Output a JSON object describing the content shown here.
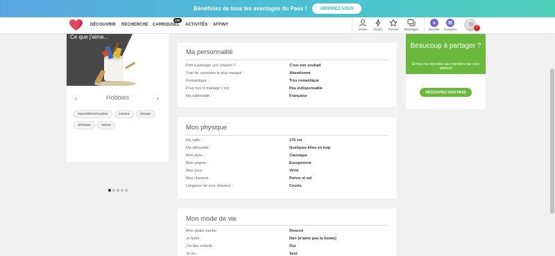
{
  "promo": {
    "text": "Bénéficiez de tous les avantages du Pass !",
    "button": "ABONNEZ-VOUS"
  },
  "nav": {
    "links": [
      "DÉCOUVRIR",
      "RECHERCHE",
      "CARROUSEL",
      "ACTIVITÉS",
      "AFFINY"
    ],
    "carrousel_badge": "100",
    "icons": [
      {
        "label": "Visites",
        "icon": "visitors-icon"
      },
      {
        "label": "Flashs",
        "icon": "flash-icon"
      },
      {
        "label": "Favoris",
        "icon": "star-icon"
      },
      {
        "label": "Messages",
        "icon": "messages-icon"
      }
    ],
    "boost_label": "Booster",
    "incognito_label": "Incognito",
    "alert_badge": "!"
  },
  "hobbies": {
    "image_title": "Ce que j'aime...",
    "title": "Hobbies",
    "tags": [
      "expositions/musées",
      "cuisine",
      "voyage",
      "animaux",
      "nature"
    ],
    "active_slide": 1,
    "slide_count": 5
  },
  "personality": {
    "title": "Ma personnalité",
    "rows": [
      {
        "label": "Prêt à partager une relation ?",
        "value": "C'est son souhait"
      },
      {
        "label": "Trait de caractère le plus marqué :",
        "value": "Attentionné"
      },
      {
        "label": "Romantique :",
        "value": "Très romantique"
      },
      {
        "label": "Pour moi le mariage c'est :",
        "value": "Pas indispensable"
      },
      {
        "label": "Ma nationalité :",
        "value": "Française"
      }
    ]
  },
  "physique": {
    "title": "Mon physique",
    "rows": [
      {
        "label": "Ma taille :",
        "value": "170 cm"
      },
      {
        "label": "Ma silhouette :",
        "value": "Quelques kilos en trop"
      },
      {
        "label": "Mon style :",
        "value": "Classique"
      },
      {
        "label": "Mon origine :",
        "value": "Européenne"
      },
      {
        "label": "Mes yeux :",
        "value": "Verts"
      },
      {
        "label": "Mes cheveux :",
        "value": "Poivre et sel"
      },
      {
        "label": "Longueur de mes cheveux :",
        "value": "Courts"
      }
    ]
  },
  "lifestyle": {
    "title": "Mon mode de vie",
    "rows": [
      {
        "label": "Mon statut marital :",
        "value": "Divorcé"
      },
      {
        "label": "Je fume :",
        "value": "Non (n'aime pas la fumée)"
      },
      {
        "label": "J'ai des enfants :",
        "value": "Oui"
      },
      {
        "label": "Je vis :",
        "value": "Seul"
      }
    ]
  },
  "cta": {
    "title": "Beaucoup à partager ?",
    "subtitle": "Écrivez ou répondez aux membres qui vous plaisent",
    "button": "DÉCOUVREZ NOS PASS"
  },
  "colors": {
    "brand_green": "#6ab93c",
    "boost_purple": "#6f68d9",
    "alert_red": "#e02424"
  }
}
